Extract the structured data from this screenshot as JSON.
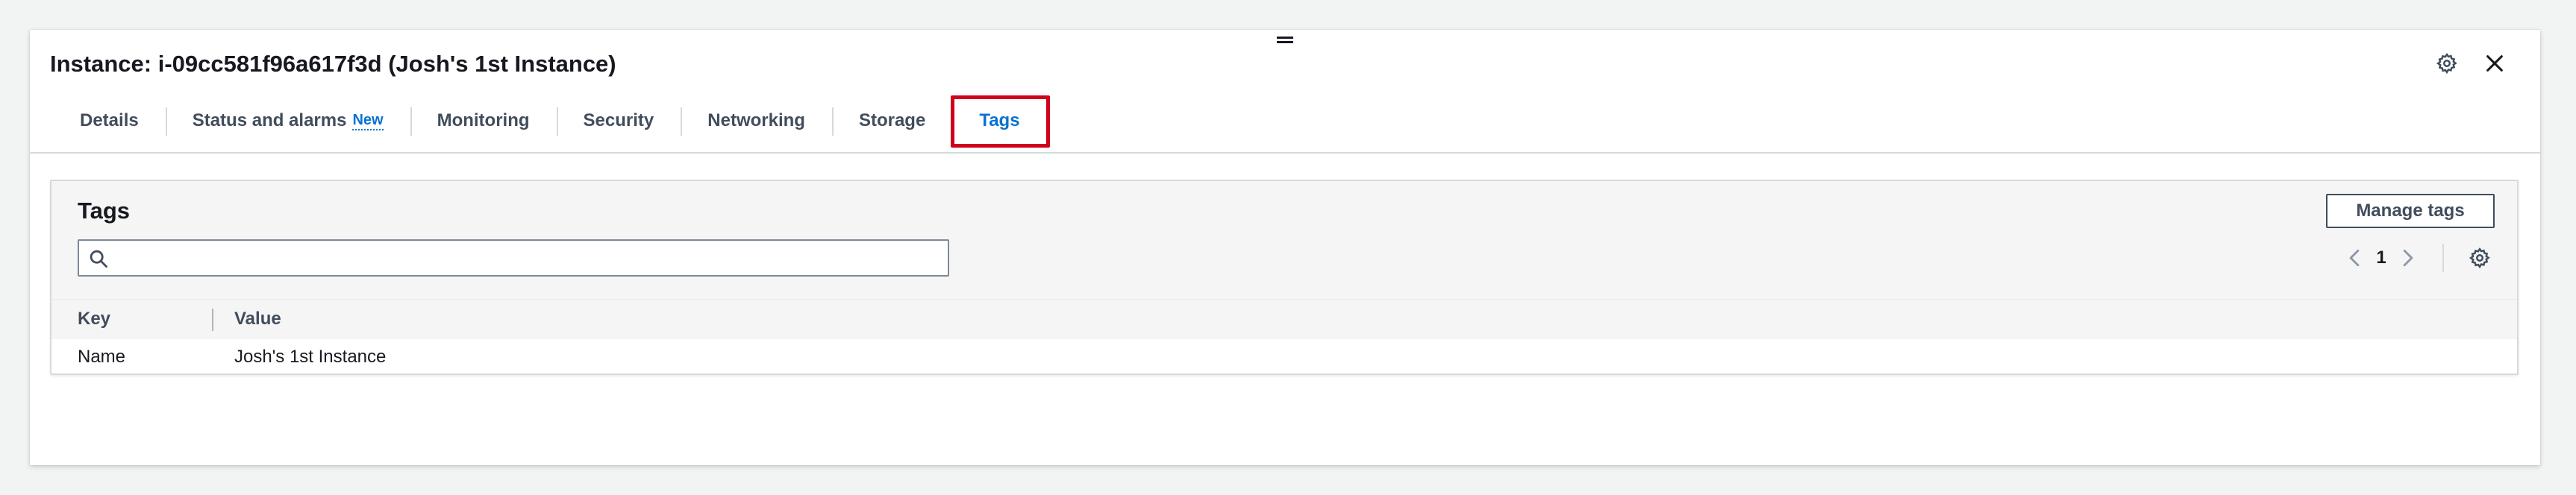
{
  "header": {
    "title": "Instance: i-09cc581f96a617f3d (Josh's 1st Instance)",
    "icons": [
      "settings-icon",
      "close-icon"
    ]
  },
  "tabs": [
    {
      "label": "Details",
      "active": false
    },
    {
      "label": "Status and alarms",
      "badge": "New",
      "active": false
    },
    {
      "label": "Monitoring",
      "active": false
    },
    {
      "label": "Security",
      "active": false
    },
    {
      "label": "Networking",
      "active": false
    },
    {
      "label": "Storage",
      "active": false
    },
    {
      "label": "Tags",
      "active": true
    }
  ],
  "tags_panel": {
    "title": "Tags",
    "manage_button": "Manage tags",
    "search_placeholder": "",
    "page": "1",
    "columns": [
      "Key",
      "Value"
    ],
    "rows": [
      {
        "key": "Name",
        "value": "Josh's 1st Instance"
      }
    ]
  },
  "colors": {
    "accent": "#0972d3",
    "highlight": "#d0021b",
    "text": "#16191f"
  }
}
